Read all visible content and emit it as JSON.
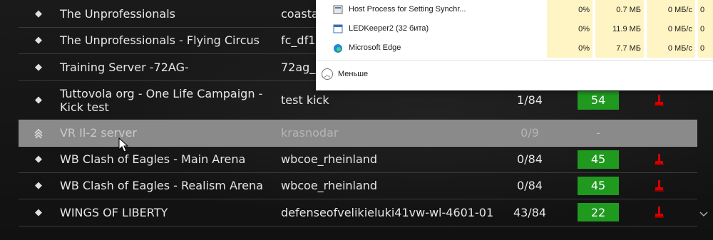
{
  "servers": [
    {
      "name": "The Unprofessionals",
      "map": "coasta",
      "players": "",
      "ping": "",
      "lock": false,
      "icon": "diamond-icon"
    },
    {
      "name": "The Unprofessionals - Flying Circus",
      "map": "fc_df1",
      "players": "",
      "ping": "",
      "lock": false,
      "icon": "diamond-icon"
    },
    {
      "name": "Training Server -72AG-",
      "map": "72ag_",
      "players": "",
      "ping": "",
      "lock": false,
      "icon": "diamond-icon"
    },
    {
      "name": "Tuttovola org - One Life Campaign - Kick test",
      "map": "test kick",
      "players": "1/84",
      "ping": "54",
      "lock": true,
      "icon": "diamond-icon"
    },
    {
      "name": "VR Il-2 server",
      "map": "krasnodar",
      "players": "0/9",
      "ping": "-",
      "lock": false,
      "icon": "chevrons-up-icon",
      "selected": true
    },
    {
      "name": "WB Clash of Eagles - Main Arena",
      "map": "wbcoe_rheinland",
      "players": "0/84",
      "ping": "45",
      "lock": true,
      "icon": "diamond-icon"
    },
    {
      "name": "WB Clash of Eagles - Realism Arena",
      "map": "wbcoe_rheinland",
      "players": "0/84",
      "ping": "45",
      "lock": true,
      "icon": "diamond-icon"
    },
    {
      "name": "WINGS OF LIBERTY",
      "map": "defenseofvelikieluki41vw-wl-4601-01",
      "players": "43/84",
      "ping": "22",
      "lock": true,
      "icon": "diamond-icon"
    }
  ],
  "task_manager": {
    "processes": [
      {
        "name": "Host Process for Setting Synchr...",
        "cpu": "0%",
        "memory": "0.7 МБ",
        "disk": "0 МБ/с",
        "network": "0",
        "icon": "gear-icon"
      },
      {
        "name": "LEDKeeper2 (32 бита)",
        "cpu": "0%",
        "memory": "11.9 МБ",
        "disk": "0 МБ/с",
        "network": "0",
        "icon": "window-icon"
      },
      {
        "name": "Microsoft Edge",
        "cpu": "0%",
        "memory": "7.7 МБ",
        "disk": "0 МБ/с",
        "network": "0",
        "icon": "edge-icon"
      }
    ],
    "fewer_details_label": "Меньше"
  },
  "colors": {
    "ping_good": "#1f9a1f",
    "lock_red": "#d40000",
    "selected_row": "#8a8a8a",
    "tm_highlight": "#fff4c4"
  }
}
